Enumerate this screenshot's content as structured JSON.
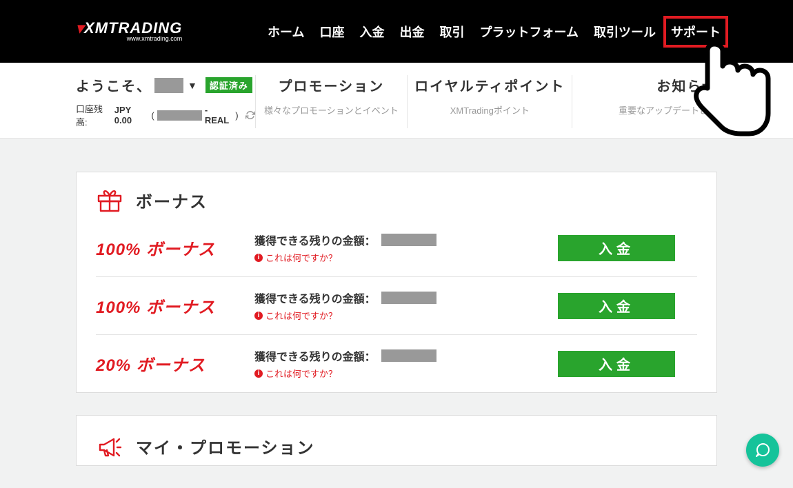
{
  "header": {
    "logo": {
      "brand_pre": "XM",
      "brand_post": "TRADING",
      "tagline": "www.xmtrading.com"
    },
    "nav": {
      "home": "ホーム",
      "account": "口座",
      "deposit": "入金",
      "withdraw": "出金",
      "trade": "取引",
      "platform": "プラットフォーム",
      "tools": "取引ツール",
      "support": "サポート"
    }
  },
  "subbar": {
    "welcome_prefix": "ようこそ、",
    "verified_badge": "認証済み",
    "balance_label": "口座残高:",
    "balance_amount": "JPY 0.00",
    "account_open": "(",
    "account_close": ")",
    "account_type": " - REAL",
    "tabs": {
      "promo": {
        "title": "プロモーション",
        "desc": "様々なプロモーションとイベント"
      },
      "loyalty": {
        "title": "ロイヤルティポイント",
        "desc": "XMTradingポイント"
      },
      "news": {
        "title": "お知らせ",
        "desc": "重要なアップデート＆リ"
      }
    }
  },
  "bonus_panel": {
    "title": "ボーナス",
    "rows": [
      {
        "name": "100% ボーナス"
      },
      {
        "name": "100% ボーナス"
      },
      {
        "name": "20% ボーナス"
      }
    ],
    "remaining_label": "獲得できる残りの金額：",
    "whatis": "これは何ですか？",
    "deposit_button": "入金"
  },
  "promo_panel": {
    "title": "マイ・プロモーション"
  }
}
